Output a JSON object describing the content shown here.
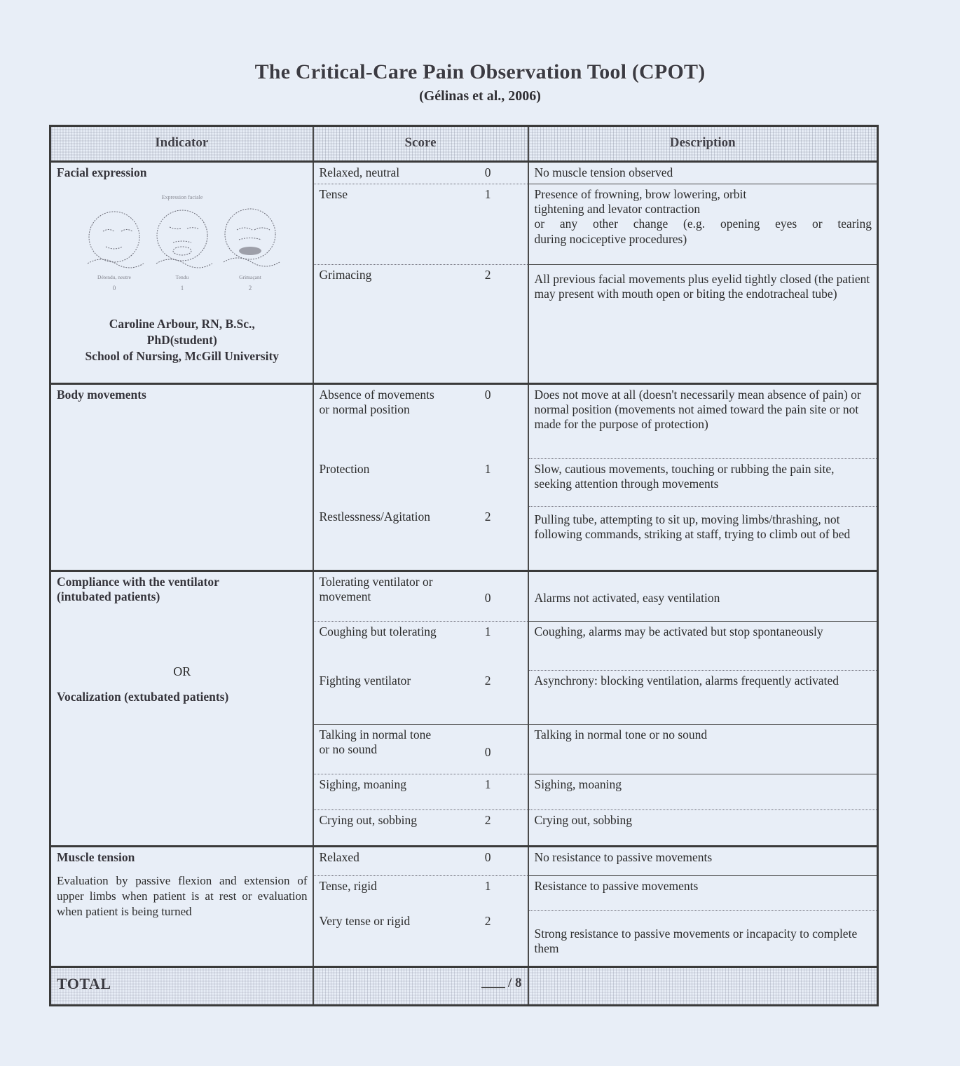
{
  "document": {
    "title": "The Critical-Care Pain Observation Tool (CPOT)",
    "subtitle": "(Gélinas et al., 2006)"
  },
  "table": {
    "headers": {
      "indicator": "Indicator",
      "score": "Score",
      "description": "Description"
    },
    "sections": [
      {
        "indicator": "Facial expression",
        "figure": {
          "caption_top": "Expression faciale",
          "face_labels": [
            "Détendu, neutre",
            "Tendu",
            "Grimaçant"
          ],
          "face_scores": [
            "0",
            "1",
            "2"
          ]
        },
        "credit_lines": [
          "Caroline Arbour, RN, B.Sc.,",
          "PhD(student)",
          "School of Nursing, McGill University"
        ],
        "rows": [
          {
            "score_label": "Relaxed, neutral",
            "score_value": "0",
            "description": "No muscle tension observed"
          },
          {
            "score_label": "Tense",
            "score_value": "1",
            "description": "Presence of frowning, brow lowering, orbit tightening and levator contraction\nor any other change (e.g. opening eyes or tearing during nociceptive procedures)"
          },
          {
            "score_label": "Grimacing",
            "score_value": "2",
            "description": "All previous facial movements plus eyelid tightly closed (the patient may present with mouth open or biting the endotracheal tube)"
          }
        ]
      },
      {
        "indicator": "Body movements",
        "rows": [
          {
            "score_label": "Absence of movements or normal position",
            "score_value": "0",
            "description": "Does not move at all (doesn't necessarily mean absence of pain) or normal position (movements not aimed toward the pain site or not made for the purpose of protection)"
          },
          {
            "score_label": "Protection",
            "score_value": "1",
            "description": "Slow, cautious movements, touching or rubbing the pain site, seeking attention through movements"
          },
          {
            "score_label": "Restlessness/Agitation",
            "score_value": "2",
            "description": "Pulling tube, attempting to sit up, moving limbs/thrashing, not following commands, striking at staff, trying to climb out of bed"
          }
        ]
      },
      {
        "indicator": "Compliance with the ventilator",
        "indicator_sub": "(intubated patients)",
        "or_text": "OR",
        "indicator_alt": "Vocalization (extubated patients)",
        "rows": [
          {
            "score_label": "Tolerating ventilator or movement",
            "score_value": "0",
            "description": "Alarms not activated, easy ventilation"
          },
          {
            "score_label": "Coughing but tolerating",
            "score_value": "1",
            "description": "Coughing, alarms may be activated but stop spontaneously"
          },
          {
            "score_label": "Fighting ventilator",
            "score_value": "2",
            "description": "Asynchrony: blocking ventilation, alarms frequently activated"
          },
          {
            "score_label": "Talking in normal tone or no sound",
            "score_value": "0",
            "description": "Talking in normal tone or no sound"
          },
          {
            "score_label": "Sighing, moaning",
            "score_value": "1",
            "description": "Sighing, moaning"
          },
          {
            "score_label": "Crying out, sobbing",
            "score_value": "2",
            "description": "Crying out, sobbing"
          }
        ]
      },
      {
        "indicator": "Muscle tension",
        "indicator_note": "Evaluation by passive flexion and extension of upper limbs when patient is at rest or evaluation when patient is being turned",
        "rows": [
          {
            "score_label": "Relaxed",
            "score_value": "0",
            "description": "No resistance to passive movements"
          },
          {
            "score_label": "Tense, rigid",
            "score_value": "1",
            "description": "Resistance to passive movements"
          },
          {
            "score_label": "Very tense or rigid",
            "score_value": "2",
            "description": "Strong resistance to passive movements or incapacity to complete them"
          }
        ]
      }
    ],
    "total": {
      "label": "TOTAL",
      "value": "",
      "max": "/ 8"
    }
  },
  "colors": {
    "page_background": "#e8eef7",
    "text": "#2b2b2b",
    "border": "#3a3a3a"
  }
}
